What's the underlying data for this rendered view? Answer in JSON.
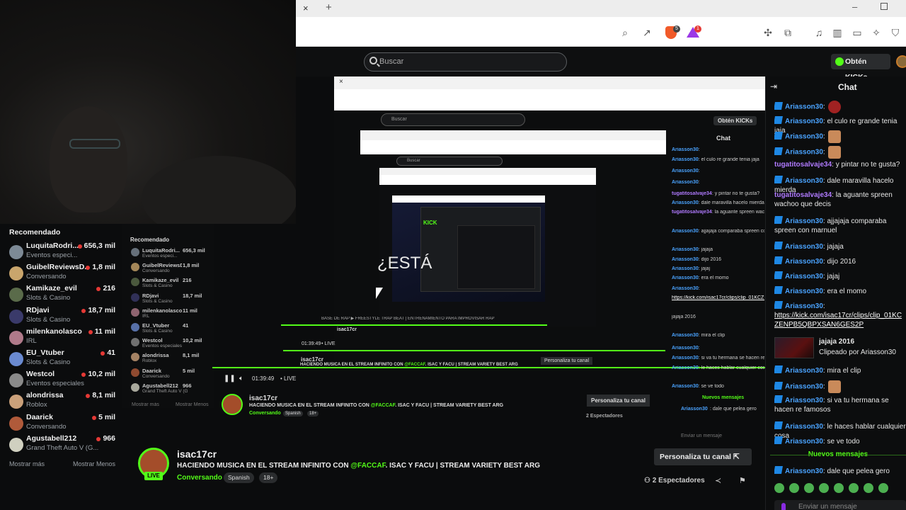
{
  "browser": {
    "tab_close": "×",
    "tab_new": "+",
    "win_min": "–",
    "brave_badge": "5",
    "tri_badge": "1"
  },
  "header": {
    "search_placeholder": "Buscar",
    "kicks_button": "Obtén KICKs"
  },
  "sidebar": {
    "title": "Recomendado",
    "items": [
      {
        "name": "LuquitaRodri...",
        "sub": "Eventos especi...",
        "count": "656,3 mil",
        "avatar_color": "#7d8a96"
      },
      {
        "name": "GuibelReviewsD...",
        "sub": "Conversando",
        "count": "1,8 mil",
        "avatar_color": "#c9a56c"
      },
      {
        "name": "Kamikaze_evil",
        "sub": "Slots & Casino",
        "count": "216",
        "avatar_color": "#5a6b4a"
      },
      {
        "name": "RDjavi",
        "sub": "Slots & Casino",
        "count": "18,7 mil",
        "avatar_color": "#3a3a6a"
      },
      {
        "name": "milenkanolasco",
        "sub": "IRL",
        "count": "11 mil",
        "avatar_color": "#b07a8a"
      },
      {
        "name": "EU_Vtuber",
        "sub": "Slots & Casino",
        "count": "41",
        "avatar_color": "#6a8ad0"
      },
      {
        "name": "Westcol",
        "sub": "Eventos especiales",
        "count": "10,2 mil",
        "avatar_color": "#8a8a8a"
      },
      {
        "name": "alondrissa",
        "sub": "Roblox",
        "count": "8,1 mil",
        "avatar_color": "#caa07a"
      },
      {
        "name": "Daarick",
        "sub": "Conversando",
        "count": "5 mil",
        "avatar_color": "#b05a3a"
      },
      {
        "name": "Agustabell212",
        "sub": "Grand Theft Auto V (G...",
        "count": "966",
        "avatar_color": "#d0d0c0"
      }
    ],
    "show_more": "Mostrar más",
    "show_less": "Mostrar Menos"
  },
  "nested": {
    "estas": "¿ESTÁ",
    "mid_search": "Buscar",
    "mid_kicks": "Obtén KICKs",
    "mid_chat": "Chat",
    "mid_recomendado": "Recomendado",
    "mid_time": "01:39:49",
    "mid_live": "• LIVE",
    "mid_stream_name": "isac17cr",
    "mid_stream_title_a": "HACIENDO MUSICA EN EL STREAM INFINITO CON ",
    "mid_stream_title_b": "@FACCAF",
    "mid_stream_title_c": ". ISAC Y FACU | STREAM VARIETY BEST ARG",
    "mid_category": "Conversando",
    "mid_lang": "Spanish",
    "mid_age": "18+",
    "mid_customize": "Personaliza tu canal",
    "mid_viewers": "2 Espectadores",
    "mid_new_msgs": "Nuevos mensajes",
    "mid_chat_input": "Enviar un mensaje",
    "mid_show_more": "Mostrar más",
    "mid_show_less": "Mostrar Menos",
    "inner_kick": "KICK",
    "inner_banner": "BASE DE RAP ▶ FREESTYLE TRAP BEAT | ENTRENAMIENTO PARA IMPROVISAR RAP"
  },
  "stream": {
    "name": "isac17cr",
    "live": "LIVE",
    "title_a": "HACIENDO MUSICA EN EL STREAM INFINITO CON ",
    "title_b": "@FACCAF",
    "title_c": ". ISAC Y FACU | STREAM VARIETY BEST ARG",
    "category": "Conversando",
    "language": "Spanish",
    "age": "18+",
    "customize": "Personaliza tu canal ⇱",
    "viewers": "2 Espectadores"
  },
  "chat": {
    "title": "Chat",
    "messages": [
      {
        "user": "Ariasson30",
        "text": ":",
        "emote": true,
        "red": true
      },
      {
        "user": "Ariasson30",
        "text": ": el culo re grande tenia jaja"
      },
      {
        "user": "Ariasson30",
        "text": ":",
        "emote": true
      },
      {
        "user": "Ariasson30",
        "text": ":",
        "emote": true
      },
      {
        "user": "tugatitosalvaje34",
        "text": ": y pintar no te gusta?"
      },
      {
        "user": "Ariasson30",
        "text": ": dale maravilla hacelo mierda"
      },
      {
        "user": "tugatitosalvaje34",
        "text": ": la aguante spreen wachoo que decis"
      },
      {
        "user": "Ariasson30",
        "text": ": ajjajaja comparaba spreen con marnuel"
      },
      {
        "user": "Ariasson30",
        "text": ": jajaja"
      },
      {
        "user": "Ariasson30",
        "text": ": dijo 2016"
      },
      {
        "user": "Ariasson30",
        "text": ": jajaj"
      },
      {
        "user": "Ariasson30",
        "text": ": era el momo"
      },
      {
        "user": "Ariasson30",
        "text": ":"
      },
      {
        "user": "",
        "text": "https://kick.com/isac17cr/clips/clip_01KCZENPB5QBPXSAN6GES2P"
      },
      {
        "user": "",
        "text": "jajaja 2016"
      },
      {
        "user": "",
        "text": "Clipeado por Ariasson30"
      },
      {
        "user": "Ariasson30",
        "text": ": mira el clip"
      },
      {
        "user": "Ariasson30",
        "text": ":",
        "emote": true
      },
      {
        "user": "Ariasson30",
        "text": ": si va tu hermana se hacen re famosos"
      },
      {
        "user": "Ariasson30",
        "text": ": le haces hablar cualquier cosa"
      },
      {
        "user": "Ariasson30",
        "text": ": se ve todo"
      },
      {
        "user": "Ariasson30",
        "text": ": dale que pelea gero"
      }
    ],
    "new_messages": "Nuevos mensajes",
    "input_placeholder": "Enviar un mensaje"
  },
  "colors": {
    "kick_green": "#53fc18",
    "chat_blue": "#4aa3ff",
    "chat_purple": "#b07aff"
  }
}
